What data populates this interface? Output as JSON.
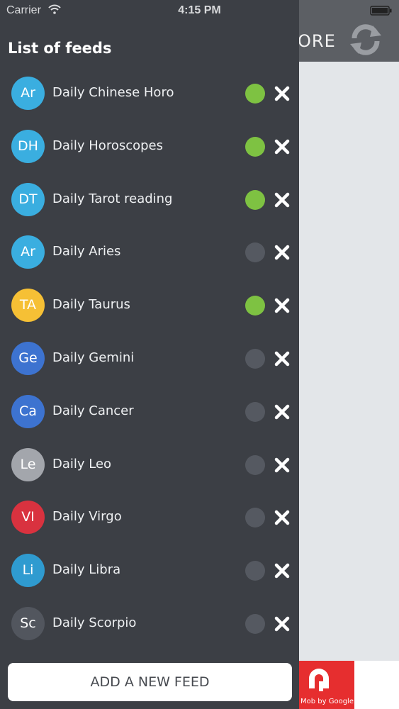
{
  "status_bar": {
    "carrier": "Carrier",
    "time": "4:15 PM"
  },
  "background": {
    "title_fragment": "ORE",
    "ad": {
      "text": "Mob by Google",
      "color": "#e62e2f"
    }
  },
  "drawer": {
    "title": "List of feeds",
    "add_button_label": "ADD A NEW FEED",
    "feeds": [
      {
        "initials": "Ar",
        "name": "Daily Chinese Horo",
        "color": "#3aaee0",
        "active": true
      },
      {
        "initials": "DH",
        "name": "Daily Horoscopes",
        "color": "#3aaee0",
        "active": true
      },
      {
        "initials": "DT",
        "name": "Daily Tarot reading",
        "color": "#3aaee0",
        "active": true
      },
      {
        "initials": "Ar",
        "name": "Daily Aries",
        "color": "#3aaee0",
        "active": false
      },
      {
        "initials": "TA",
        "name": "Daily Taurus",
        "color": "#f6c035",
        "active": true
      },
      {
        "initials": "Ge",
        "name": "Daily Gemini",
        "color": "#3d73d0",
        "active": false
      },
      {
        "initials": "Ca",
        "name": "Daily Cancer",
        "color": "#3d73d0",
        "active": false
      },
      {
        "initials": "Le",
        "name": "Daily Leo",
        "color": "#a3a6ac",
        "active": false
      },
      {
        "initials": "VI",
        "name": "Daily Virgo",
        "color": "#d9323f",
        "active": false
      },
      {
        "initials": "Li",
        "name": "Daily Libra",
        "color": "#2f9bd0",
        "active": false
      },
      {
        "initials": "Sc",
        "name": "Daily Scorpio",
        "color": "#52565e",
        "active": false
      }
    ]
  },
  "colors": {
    "active_dot": "#7ec242",
    "inactive_dot": "#555961",
    "drawer_bg": "#3c3f45"
  }
}
